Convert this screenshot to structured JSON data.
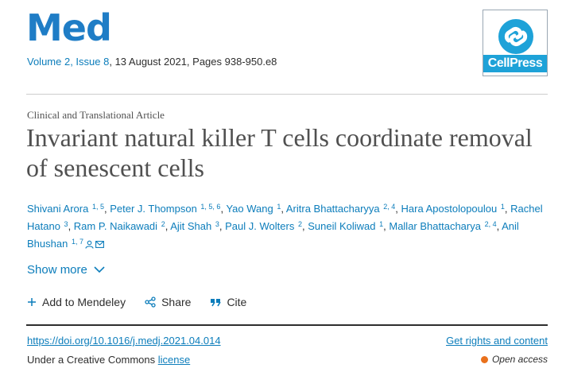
{
  "journal": {
    "name": "Med",
    "volume": "Volume 2, Issue 8",
    "issue_details": ", 13 August 2021, Pages 938-950.e8"
  },
  "publisher": {
    "logo_text": "CellPress"
  },
  "article": {
    "type": "Clinical and Translational Article",
    "title": "Invariant natural killer T cells coordinate removal of senescent cells"
  },
  "authors": [
    {
      "name": "Shivani Arora",
      "sup": "1, 5"
    },
    {
      "name": "Peter J. Thompson",
      "sup": "1, 5, 6"
    },
    {
      "name": "Yao Wang",
      "sup": "1"
    },
    {
      "name": "Aritra Bhattacharyya",
      "sup": "2, 4"
    },
    {
      "name": "Hara Apostolopoulou",
      "sup": "1"
    },
    {
      "name": "Rachel Hatano",
      "sup": "3"
    },
    {
      "name": "Ram P. Naikawadi",
      "sup": "2"
    },
    {
      "name": "Ajit Shah",
      "sup": "3"
    },
    {
      "name": "Paul J. Wolters",
      "sup": "2"
    },
    {
      "name": "Suneil Koliwad",
      "sup": "1"
    },
    {
      "name": "Mallar Bhattacharya",
      "sup": "2, 4"
    },
    {
      "name": "Anil Bhushan",
      "sup": "1, 7"
    }
  ],
  "show_more": "Show more",
  "actions": {
    "mendeley": "Add to Mendeley",
    "share": "Share",
    "cite": "Cite"
  },
  "footer": {
    "doi": "https://doi.org/10.1016/j.medj.2021.04.014",
    "rights": "Get rights and content",
    "license_prefix": "Under a Creative Commons ",
    "license_link": "license",
    "open_access": "Open access"
  },
  "colors": {
    "link": "#0c7dbb",
    "journal_logo": "#1f7dc6",
    "open_access_dot": "#e9711c"
  }
}
